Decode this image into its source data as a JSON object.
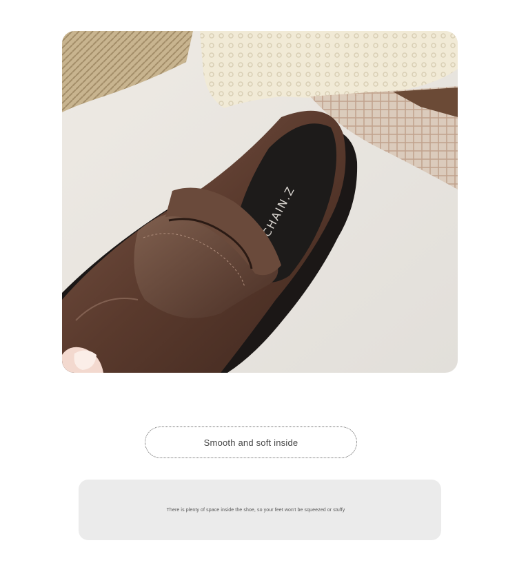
{
  "photo": {
    "subject": "brown leather loafer shoe interior",
    "insole_print": "CHAIN.Z"
  },
  "caption": {
    "title": "Smooth and soft inside"
  },
  "description": {
    "text": "There is plenty of space inside the shoe, so your feet won't be squeezed or stuffy"
  },
  "colors": {
    "leather": "#5b3b2e",
    "leather_highlight": "#8a6656",
    "insole": "#1c1a19",
    "background_cloth": "#e9e6e1",
    "caption_border": "#666666",
    "desc_box": "#ebebeb"
  }
}
